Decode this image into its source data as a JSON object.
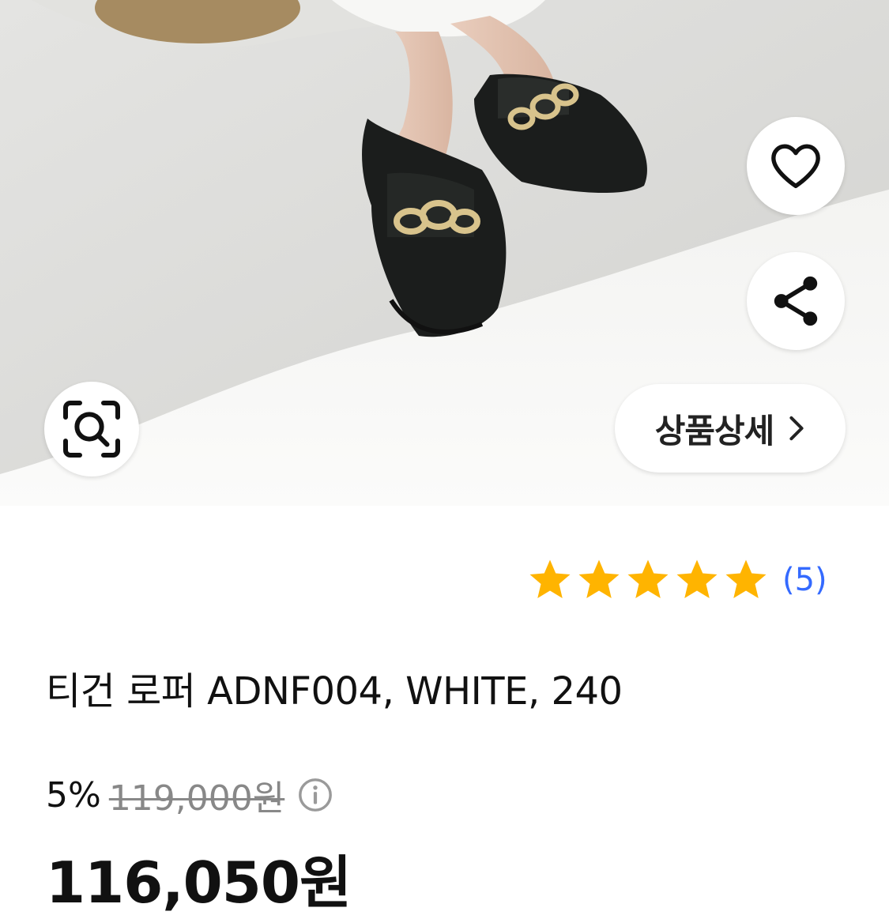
{
  "product_image": {
    "description_icon": "product-photo",
    "actions": {
      "wishlist_icon": "heart-icon",
      "share_icon": "share-icon",
      "image_search_icon": "image-search-icon"
    },
    "detail_button": {
      "label": "상품상세",
      "icon": "chevron-right-icon"
    }
  },
  "rating": {
    "stars": 5,
    "max_stars": 5,
    "count": "(5)",
    "star_color": "#ffb400",
    "count_color": "#346aff"
  },
  "product": {
    "title": "티건 로퍼 ADNF004, WHITE, 240"
  },
  "price": {
    "discount_rate": "5%",
    "original_price": "119,000원",
    "info_icon": "info-icon",
    "sale_price": "116,050원"
  }
}
